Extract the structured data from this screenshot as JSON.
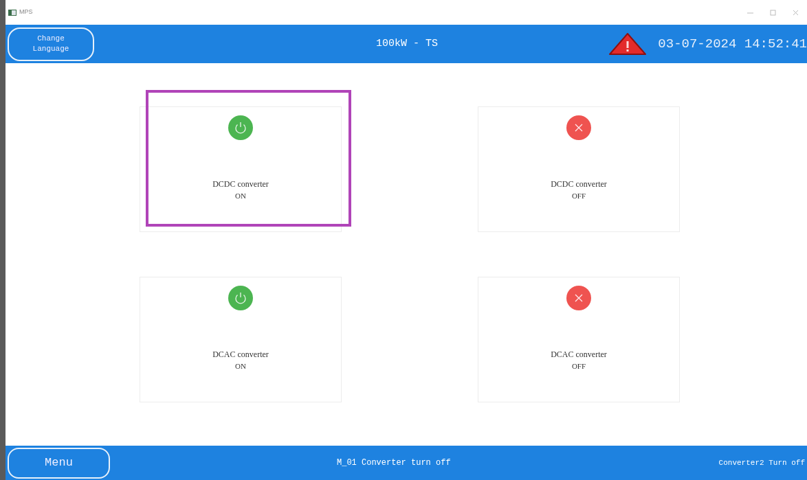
{
  "window": {
    "title": "MPS"
  },
  "header": {
    "language_button": "Change\nLanguage",
    "title": "100kW - TS",
    "alarm": true,
    "datetime": "03-07-2024 14:52:41"
  },
  "cards": [
    {
      "kind": "on",
      "name": "DCDC converter",
      "status": "ON",
      "selected": true
    },
    {
      "kind": "off",
      "name": "DCDC converter",
      "status": "OFF",
      "selected": false
    },
    {
      "kind": "on",
      "name": "DCAC converter",
      "status": "ON",
      "selected": false
    },
    {
      "kind": "off",
      "name": "DCAC converter",
      "status": "OFF",
      "selected": false
    }
  ],
  "footer": {
    "menu_button": "Menu",
    "message": "M_01 Converter turn off",
    "status": "Converter2 Turn off"
  }
}
